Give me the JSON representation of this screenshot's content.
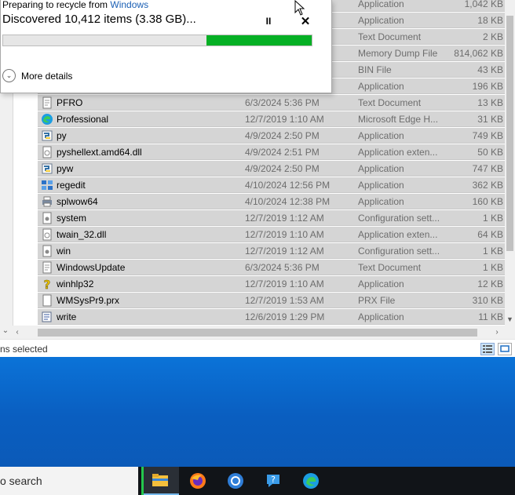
{
  "dialog": {
    "title_prefix": "Preparing to recycle from ",
    "title_source": "Windows",
    "status": "Discovered 10,412 items (3.38 GB)...",
    "pause_label": "II",
    "close_label": "✕",
    "progress": 0.34,
    "more_details_label": "More details",
    "colors": {
      "progress_fill": "#06b025",
      "link": "#1a5fb4"
    }
  },
  "files": [
    {
      "name": "",
      "date": "",
      "type": "Application",
      "size": "1,042 KB",
      "icon": "app-icon"
    },
    {
      "name": "",
      "date": "",
      "type": "Application",
      "size": "18 KB",
      "icon": "app-icon"
    },
    {
      "name": "",
      "date": "",
      "type": "Text Document",
      "size": "2 KB",
      "icon": "text-doc-icon"
    },
    {
      "name": "",
      "date": "",
      "type": "Memory Dump File",
      "size": "814,062 KB",
      "icon": "dump-file-icon"
    },
    {
      "name": "",
      "date": "",
      "type": "BIN File",
      "size": "43 KB",
      "icon": "bin-file-icon"
    },
    {
      "name": "",
      "date": "",
      "type": "Application",
      "size": "196 KB",
      "icon": "app-icon"
    },
    {
      "name": "PFRO",
      "date": "6/3/2024 5:36 PM",
      "type": "Text Document",
      "size": "13 KB",
      "icon": "text-doc-icon"
    },
    {
      "name": "Professional",
      "date": "12/7/2019 1:10 AM",
      "type": "Microsoft Edge H...",
      "size": "31 KB",
      "icon": "edge-icon"
    },
    {
      "name": "py",
      "date": "4/9/2024 2:50 PM",
      "type": "Application",
      "size": "749 KB",
      "icon": "python-icon"
    },
    {
      "name": "pyshellext.amd64.dll",
      "date": "4/9/2024 2:51 PM",
      "type": "Application exten...",
      "size": "50 KB",
      "icon": "dll-icon"
    },
    {
      "name": "pyw",
      "date": "4/9/2024 2:50 PM",
      "type": "Application",
      "size": "747 KB",
      "icon": "python-icon"
    },
    {
      "name": "regedit",
      "date": "4/10/2024 12:56 PM",
      "type": "Application",
      "size": "362 KB",
      "icon": "regedit-icon"
    },
    {
      "name": "splwow64",
      "date": "4/10/2024 12:38 PM",
      "type": "Application",
      "size": "160 KB",
      "icon": "printer-icon"
    },
    {
      "name": "system",
      "date": "12/7/2019 1:12 AM",
      "type": "Configuration sett...",
      "size": "1 KB",
      "icon": "config-icon"
    },
    {
      "name": "twain_32.dll",
      "date": "12/7/2019 1:10 AM",
      "type": "Application exten...",
      "size": "64 KB",
      "icon": "dll-icon"
    },
    {
      "name": "win",
      "date": "12/7/2019 1:12 AM",
      "type": "Configuration sett...",
      "size": "1 KB",
      "icon": "config-icon"
    },
    {
      "name": "WindowsUpdate",
      "date": "6/3/2024 5:36 PM",
      "type": "Text Document",
      "size": "1 KB",
      "icon": "text-doc-icon"
    },
    {
      "name": "winhlp32",
      "date": "12/7/2019 1:10 AM",
      "type": "Application",
      "size": "12 KB",
      "icon": "help-icon"
    },
    {
      "name": "WMSysPr9.prx",
      "date": "12/7/2019 1:53 AM",
      "type": "PRX File",
      "size": "310 KB",
      "icon": "prx-file-icon"
    },
    {
      "name": "write",
      "date": "12/6/2019 1:29 PM",
      "type": "Application",
      "size": "11 KB",
      "icon": "wordpad-icon"
    }
  ],
  "statusbar": {
    "selection_text": "ns selected"
  },
  "taskbar": {
    "search_text": "o search",
    "apps": [
      "file-explorer-icon",
      "firefox-icon",
      "chrome-icon",
      "help-app-icon",
      "edge-icon"
    ]
  },
  "colors": {
    "selected_row": "#d5d5d5",
    "desktop": "#0a66c8",
    "taskbar": "#111418"
  }
}
